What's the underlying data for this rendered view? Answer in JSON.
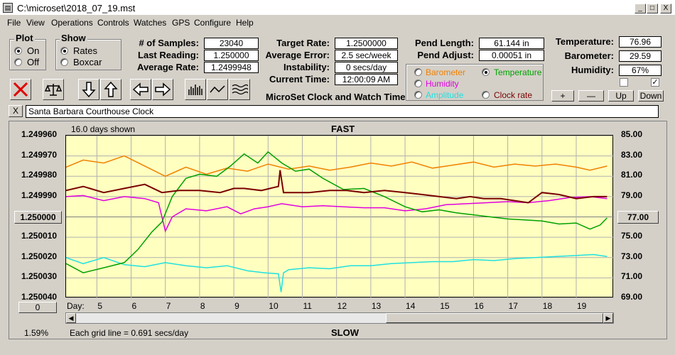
{
  "window": {
    "title": "C:\\microset\\2018_07_19.mst",
    "min": "_",
    "max": "□",
    "close": "X"
  },
  "menu": [
    "File",
    "View",
    "Operations",
    "Controls",
    "Watches",
    "GPS",
    "Configure",
    "Help"
  ],
  "plot_group": {
    "title": "Plot",
    "on": "On",
    "off": "Off",
    "selected": "On"
  },
  "show_group": {
    "title": "Show",
    "rates": "Rates",
    "boxcar": "Boxcar",
    "selected": "Rates"
  },
  "stats": {
    "samples_label": "# of Samples:",
    "samples": "23040",
    "last_label": "Last Reading:",
    "last": "1.250000",
    "avg_label": "Average Rate:",
    "avg": "1.2499948",
    "target_label": "Target Rate:",
    "target": "1.2500000",
    "error_label": "Average Error:",
    "error": "2.5 sec/week",
    "instab_label": "Instability:",
    "instab": "0 secs/day",
    "time_label": "Current Time:",
    "time": "12:00:09 AM",
    "pendlen_label": "Pend Length:",
    "pendlen": "61.144 in",
    "pendadj_label": "Pend Adjust:",
    "pendadj": "0.00051 in",
    "temp_label": "Temperature:",
    "temp": "76.96",
    "baro_label": "Barometer:",
    "baro": "29.59",
    "hum_label": "Humidity:",
    "hum": "67%"
  },
  "app_title": "MicroSet Clock and Watch Timer",
  "sensors": {
    "barometer": "Barometer",
    "temperature": "Temperature",
    "humidity": "Humidity",
    "amplitude": "Amplitude",
    "clockrate": "Clock rate",
    "selected": "Temperature"
  },
  "scale_buttons": {
    "plus": "+",
    "minus": "—",
    "up": "Up",
    "down": "Down"
  },
  "tool_icons": [
    "close-x-icon",
    "balance-scale-icon",
    "arrow-down-icon",
    "arrow-up-icon",
    "arrow-left-icon",
    "arrow-right-icon",
    "bar-chart-icon",
    "wave-icon",
    "waves-icon"
  ],
  "clock_name": "Santa Barbara Courthouse Clock",
  "clear_btn": "X",
  "chart_data": {
    "type": "line",
    "title": "FAST",
    "bottom_title": "SLOW",
    "days_shown": "16.0 days shown",
    "grid_note": "Each grid line = 0.691 secs/day",
    "percent": "1.59%",
    "left_ticks": [
      "1.249960",
      "1.249970",
      "1.249980",
      "1.249990",
      "1.250000",
      "1.250010",
      "1.250020",
      "1.250030",
      "1.250040"
    ],
    "right_ticks": [
      "85.00",
      "83.00",
      "81.00",
      "79.00",
      "77.00",
      "75.00",
      "73.00",
      "71.00",
      "69.00"
    ],
    "left_center_button": "1.250000",
    "right_center_button": "77.00",
    "bottom_left_button": "0",
    "x_label": "Day:",
    "x_ticks": [
      "5",
      "6",
      "7",
      "8",
      "9",
      "10",
      "11",
      "12",
      "13",
      "14",
      "15",
      "16",
      "17",
      "18",
      "19"
    ],
    "x_range": [
      4.1,
      20.1
    ],
    "rate_range": [
      1.24996,
      1.25004
    ],
    "temp_range": [
      69,
      85
    ],
    "series": [
      {
        "name": "Clock rate",
        "color": "#7a0000",
        "axis": "left",
        "x": [
          4.1,
          4.6,
          5.2,
          5.8,
          6.4,
          6.9,
          7.4,
          8.0,
          8.6,
          9.0,
          9.3,
          9.8,
          10.3,
          10.35,
          10.45,
          10.6,
          11.2,
          11.8,
          12.3,
          12.8,
          13.4,
          14.0,
          14.5,
          15.0,
          15.5,
          15.9,
          16.3,
          16.8,
          17.2,
          17.6,
          18.0,
          18.5,
          19.0,
          19.5,
          19.9
        ],
        "y": [
          1.249987,
          1.249985,
          1.249988,
          1.249986,
          1.249984,
          1.249988,
          1.249987,
          1.249987,
          1.249988,
          1.249986,
          1.249986,
          1.249987,
          1.249985,
          1.249977,
          1.249988,
          1.249988,
          1.249988,
          1.249987,
          1.249987,
          1.249988,
          1.249987,
          1.249988,
          1.249989,
          1.24999,
          1.249991,
          1.24999,
          1.249991,
          1.249991,
          1.249992,
          1.249993,
          1.249988,
          1.249989,
          1.249991,
          1.24999,
          1.24999
        ]
      },
      {
        "name": "Temperature",
        "color": "#00a000",
        "axis": "right",
        "x": [
          4.1,
          4.6,
          5.2,
          5.8,
          6.2,
          6.6,
          6.9,
          7.2,
          7.6,
          8.0,
          8.5,
          8.9,
          9.3,
          9.7,
          10.0,
          10.4,
          10.8,
          11.2,
          11.6,
          12.2,
          12.8,
          13.4,
          14.0,
          14.5,
          15.0,
          15.5,
          16.0,
          16.5,
          17.0,
          17.5,
          18.0,
          18.5,
          19.0,
          19.4,
          19.7,
          19.9
        ],
        "x_comment": "",
        "y": [
          72.4,
          71.5,
          72.0,
          72.5,
          73.8,
          75.5,
          76.5,
          79.0,
          80.8,
          81.2,
          81.0,
          82.0,
          83.2,
          82.3,
          83.4,
          82.3,
          81.5,
          81.7,
          80.8,
          79.7,
          79.8,
          79.0,
          78.0,
          77.5,
          77.7,
          77.4,
          77.2,
          77.0,
          76.8,
          76.7,
          76.6,
          76.3,
          76.4,
          75.8,
          76.2,
          76.9
        ]
      },
      {
        "name": "Barometer",
        "color": "#f08000",
        "axis": "right",
        "x": [
          4.1,
          4.6,
          5.2,
          5.8,
          6.4,
          7.0,
          7.6,
          8.2,
          8.8,
          9.4,
          10.0,
          10.6,
          11.2,
          11.8,
          12.4,
          13.0,
          13.6,
          14.2,
          14.8,
          15.4,
          16.0,
          16.6,
          17.2,
          17.8,
          18.4,
          19.0,
          19.4,
          19.9
        ],
        "y": [
          81.9,
          82.6,
          82.3,
          83.0,
          82.0,
          81.0,
          81.9,
          81.2,
          81.8,
          81.5,
          82.2,
          81.7,
          82.0,
          81.6,
          81.9,
          82.3,
          82.0,
          82.4,
          81.8,
          82.1,
          82.4,
          81.9,
          82.2,
          82.0,
          82.2,
          81.9,
          81.6,
          82.0
        ]
      },
      {
        "name": "Humidity",
        "color": "#e000e0",
        "axis": "right",
        "x": [
          4.1,
          4.6,
          5.2,
          5.8,
          6.4,
          6.8,
          7.0,
          7.2,
          7.6,
          8.2,
          8.8,
          9.2,
          9.6,
          10.0,
          10.4,
          11.0,
          11.6,
          12.2,
          12.8,
          13.4,
          14.0,
          14.6,
          15.2,
          15.8,
          16.4,
          17.0,
          17.6,
          18.2,
          18.8,
          19.4,
          19.9
        ],
        "y": [
          79.0,
          79.1,
          78.6,
          79.0,
          78.8,
          78.4,
          75.6,
          77.0,
          77.8,
          77.6,
          78.0,
          77.3,
          77.8,
          78.0,
          78.3,
          78.0,
          78.1,
          78.0,
          77.9,
          77.9,
          77.6,
          77.8,
          78.2,
          78.3,
          78.4,
          78.5,
          78.4,
          78.6,
          78.9,
          79.0,
          78.8
        ]
      },
      {
        "name": "Amplitude",
        "color": "#20e0e0",
        "axis": "right",
        "x": [
          4.1,
          4.6,
          5.2,
          5.8,
          6.4,
          7.0,
          7.6,
          8.2,
          8.8,
          9.4,
          9.9,
          10.3,
          10.38,
          10.45,
          10.6,
          11.2,
          11.8,
          12.4,
          13.0,
          13.6,
          14.2,
          14.8,
          15.4,
          16.0,
          16.6,
          17.2,
          17.8,
          18.4,
          19.0,
          19.5,
          19.9
        ],
        "y": [
          73.0,
          72.4,
          73.0,
          72.3,
          72.1,
          72.5,
          72.2,
          72.0,
          72.2,
          71.7,
          71.5,
          71.4,
          69.6,
          71.5,
          71.8,
          72.0,
          71.9,
          72.2,
          72.2,
          72.4,
          72.5,
          72.6,
          72.6,
          72.8,
          72.7,
          72.9,
          73.0,
          73.1,
          73.2,
          73.3,
          73.1
        ]
      }
    ]
  }
}
